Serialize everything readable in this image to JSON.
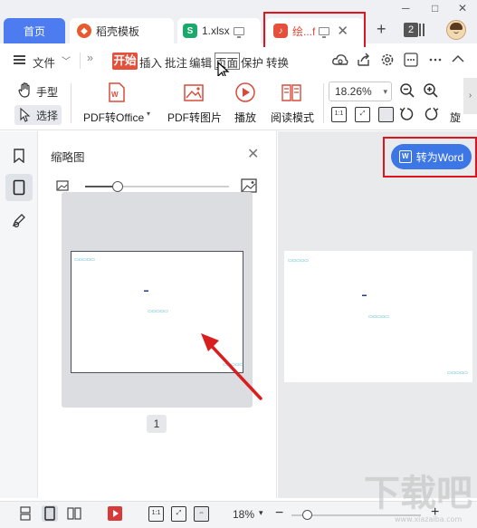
{
  "tabs": [
    {
      "label": "首页"
    },
    {
      "label": "稻壳模板",
      "icon": "daoke-logo-icon"
    },
    {
      "label": "1.xlsx",
      "icon": "spreadsheet-icon"
    },
    {
      "label": "绘...f",
      "icon": "pdf-icon"
    }
  ],
  "window": {
    "tab_count": "2",
    "win_minimize": "─",
    "win_restore": "□",
    "win_close": "✕"
  },
  "menu": {
    "file": "文件",
    "more": "»",
    "items": [
      "开始",
      "插入",
      "批注",
      "编辑",
      "页面",
      "保护",
      "转换"
    ]
  },
  "toolbar": {
    "hand": "手型",
    "select": "选择",
    "pdf_to_office": "PDF转Office",
    "pdf_to_image": "PDF转图片",
    "play": "播放",
    "read_mode": "阅读模式",
    "zoom": "18.26%",
    "rotate_label": "旋"
  },
  "sidebar": {
    "title": "缩略图",
    "page_number": "1"
  },
  "thumbnail_text": {
    "line1": "▭▭▭▭▭",
    "line2": "▬",
    "line3": "▭▭▭▭▭",
    "line4": "▭▭▭▭▭"
  },
  "doc": {
    "convert_button": "转为Word"
  },
  "status": {
    "zoom": "18%"
  },
  "watermark": {
    "text": "下载吧",
    "sub": "www.xiazaiba.com"
  },
  "colors": {
    "accent": "#3d77e6",
    "red": "#e0141e",
    "tab_home": "#4d7cf0",
    "brand_red": "#e5503b"
  }
}
